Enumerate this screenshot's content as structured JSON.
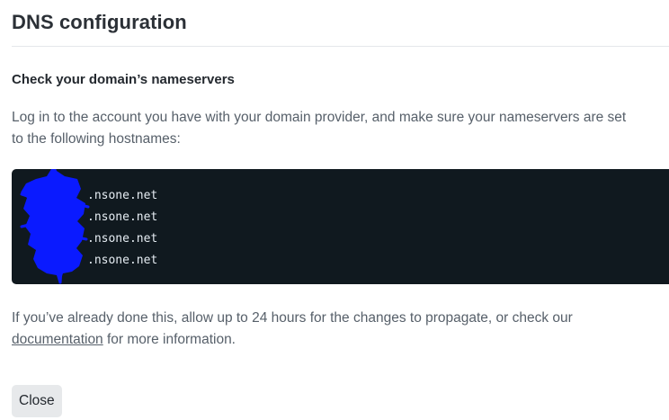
{
  "dialog": {
    "title": "DNS configuration",
    "section_heading": "Check your domain’s nameservers",
    "instructions": "Log in to the account you have with your domain provider, and make sure your nameservers are set to the following hostnames:",
    "nameservers": [
      {
        "prefix": "",
        "domain": ".nsone.net"
      },
      {
        "prefix": "",
        "domain": ".nsone.net"
      },
      {
        "prefix": "",
        "domain": ".nsone.net"
      },
      {
        "prefix": "",
        "domain": ".nsone.net"
      }
    ],
    "redaction_color": "#0a1aff",
    "footer_before_link": "If you’ve already done this, allow up to 24 hours for the changes to propagate, or check our ",
    "footer_link": "documentation",
    "footer_after_link": " for more information.",
    "close_label": "Close"
  }
}
